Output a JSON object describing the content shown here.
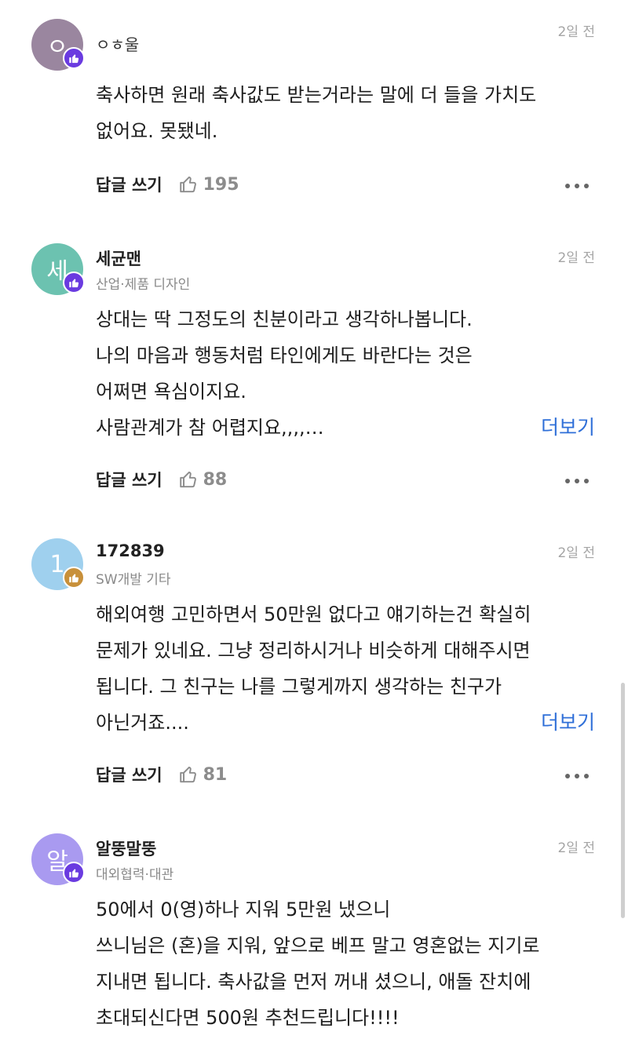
{
  "comments": [
    {
      "avatar_letter": "ㅇ",
      "avatar_color": "#9a869f",
      "badge_color": "#6a3be0",
      "name": "ㅇㅎ울",
      "job": "",
      "time": "2일 전",
      "lines": [
        "축사하면 원래 축사값도 받는거라는 말에 더 들을 가치도",
        "없어요. 못됐네."
      ],
      "more": "",
      "reply_label": "답글 쓰기",
      "likes": "195"
    },
    {
      "avatar_letter": "세",
      "avatar_color": "#6cc2b0",
      "badge_color": "#6a3be0",
      "name": "세균맨",
      "job": "산업·제품 디자인",
      "time": "2일 전",
      "lines": [
        "상대는 딱 그정도의 친분이라고 생각하나봅니다.",
        "나의 마음과 행동처럼 타인에게도 바란다는 것은",
        "어쩌면 욕심이지요.",
        "사람관계가 참 어렵지요,,,,…"
      ],
      "more": "더보기",
      "reply_label": "답글 쓰기",
      "likes": "88"
    },
    {
      "avatar_letter": "1",
      "avatar_color": "#9fd0ee",
      "badge_color": "#c8903a",
      "name": "172839",
      "job": "SW개발 기타",
      "time": "2일 전",
      "lines": [
        "해외여행 고민하면서 50만원 없다고 얘기하는건 확실히",
        "문제가 있네요. 그냥 정리하시거나 비슷하게 대해주시면",
        "됩니다. 그 친구는 나를 그렇게까지 생각하는 친구가",
        "아닌거죠...."
      ],
      "more": "더보기",
      "reply_label": "답글 쓰기",
      "likes": "81"
    },
    {
      "avatar_letter": "알",
      "avatar_color": "#a99af0",
      "badge_color": "#6a3be0",
      "name": "알뚱말뚱",
      "job": "대외협력·대관",
      "time": "2일 전",
      "lines": [
        "50에서 0(영)하나 지워 5만원 냈으니",
        "쓰니님은 (혼)을 지워, 앞으로 베프 말고 영혼없는 지기로",
        "지내면 됩니다.  축사값을 먼저 꺼내 셨으니, 애돌 잔치에",
        "초대되신다면 500원 추천드립니다!!!!"
      ],
      "more": "",
      "reply_label": "",
      "likes": ""
    }
  ],
  "icons": {
    "badge": "thumbs-up-icon",
    "like": "thumbs-up-outline-icon",
    "menu": "more-horizontal-icon"
  }
}
